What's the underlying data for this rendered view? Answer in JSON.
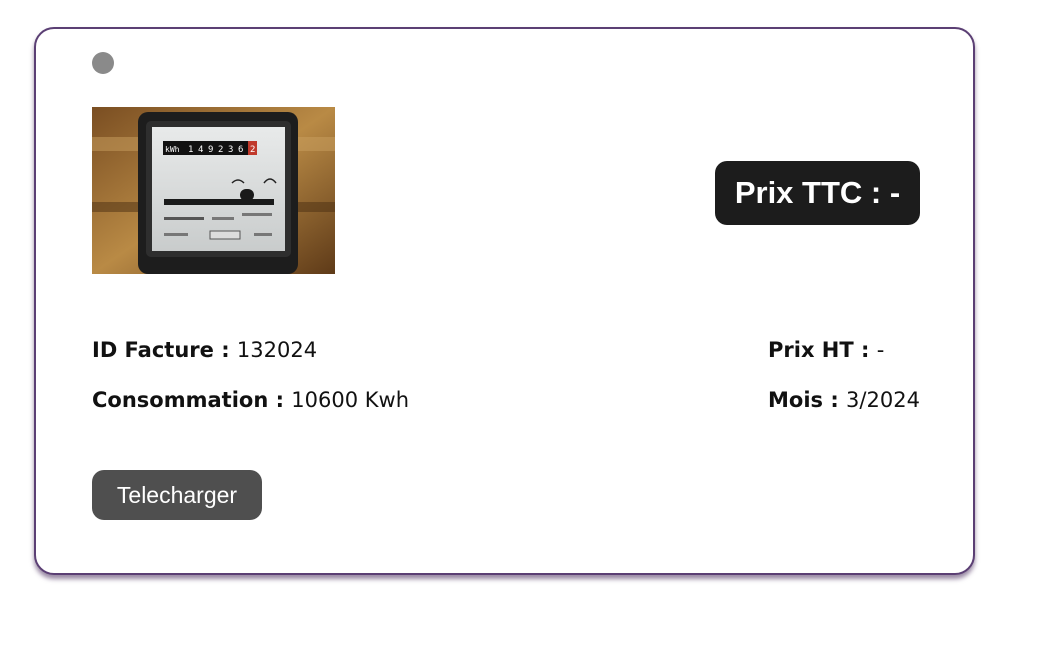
{
  "invoice": {
    "status_color": "#8a8a8a",
    "image_alt": "electricity-meter-photo",
    "ttc_label": "Prix TTC : -",
    "id_label": "ID Facture :",
    "id_value": "132024",
    "consumption_label": "Consommation :",
    "consumption_value": "10600 Kwh",
    "ht_label": "Prix HT :",
    "ht_value": "-",
    "month_label": "Mois :",
    "month_value": "3/2024",
    "download_label": "Telecharger"
  },
  "meter": {
    "unit": "kWh",
    "digits": [
      "1",
      "4",
      "9",
      "2",
      "3",
      "6"
    ],
    "last_digit": "2"
  },
  "colors": {
    "border": "#5b3f74",
    "badge_bg": "#1c1c1c",
    "button_bg": "#4f4f4f"
  }
}
